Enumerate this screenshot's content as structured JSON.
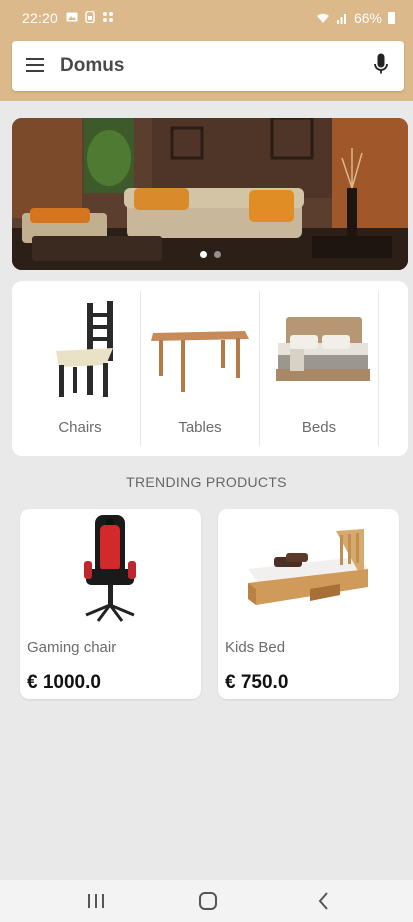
{
  "status_bar": {
    "time": "22:20",
    "battery": "66%",
    "icons": [
      "image-icon",
      "sim-icon",
      "grid-icon",
      "wifi-icon",
      "signal-icon",
      "battery-icon"
    ]
  },
  "header": {
    "title": "Domus",
    "menu_icon": "menu-icon",
    "mic_icon": "mic-icon"
  },
  "banner": {
    "slide_count": 2,
    "active_slide": 1
  },
  "categories": [
    {
      "label": "Chairs",
      "icon": "chair-image"
    },
    {
      "label": "Tables",
      "icon": "table-image"
    },
    {
      "label": "Beds",
      "icon": "bed-image"
    }
  ],
  "trending": {
    "title": "TRENDING PRODUCTS",
    "products": [
      {
        "name": "Gaming chair",
        "price": "€ 1000.0",
        "icon": "gaming-chair-image"
      },
      {
        "name": "Kids Bed",
        "price": "€ 750.0",
        "icon": "kids-bed-image"
      }
    ]
  },
  "nav_bar": {
    "buttons": [
      "recent-apps-icon",
      "home-icon",
      "back-icon"
    ]
  },
  "colors": {
    "header_band": "#dbb98a",
    "background": "#e9e9e9"
  }
}
